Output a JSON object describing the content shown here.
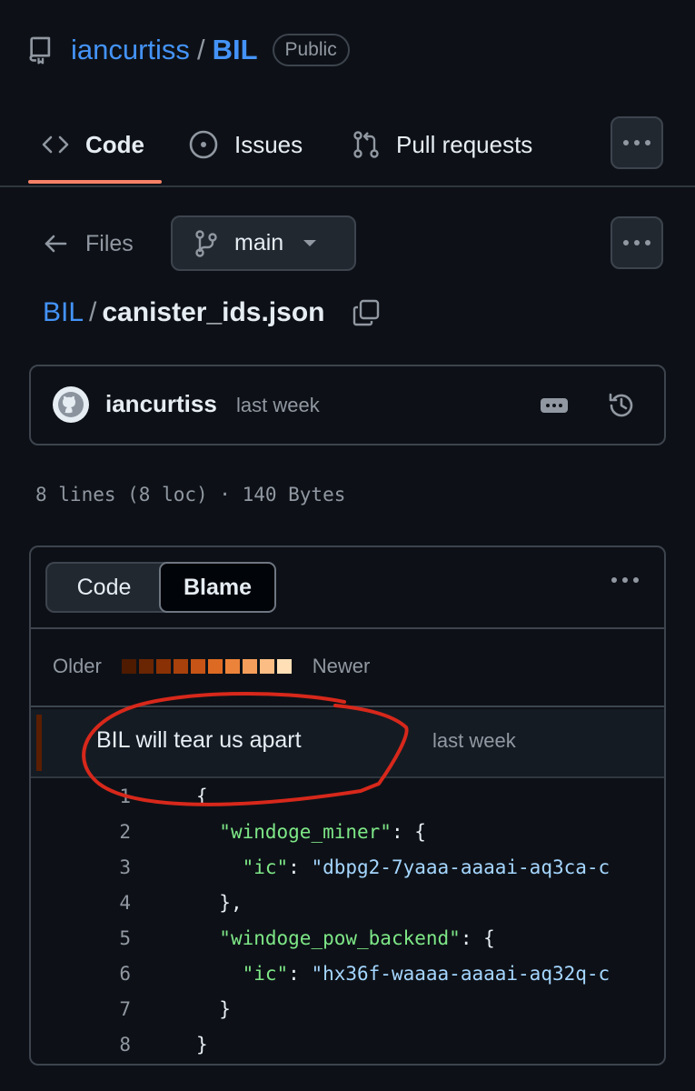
{
  "repo": {
    "owner": "iancurtiss",
    "separator": "/",
    "name": "BIL",
    "visibility": "Public"
  },
  "tabs": [
    {
      "label": "Code",
      "active": true,
      "icon": "code-icon"
    },
    {
      "label": "Issues",
      "active": false,
      "icon": "issue-opened-icon"
    },
    {
      "label": "Pull requests",
      "active": false,
      "icon": "git-pull-request-icon"
    }
  ],
  "files_nav": {
    "back_label": "Files",
    "branch": "main"
  },
  "path": {
    "root": "BIL",
    "separator": "/",
    "file": "canister_ids.json"
  },
  "latest_commit": {
    "author": "iancurtiss",
    "time": "last week"
  },
  "file_meta": "8 lines (8 loc) · 140 Bytes",
  "view_toggle": {
    "code_label": "Code",
    "blame_label": "Blame",
    "active": "Blame"
  },
  "age_legend": {
    "older_label": "Older",
    "newer_label": "Newer",
    "colors": [
      "#4e1a00",
      "#6a2503",
      "#8a3105",
      "#a8410b",
      "#c65416",
      "#dd6a23",
      "#ec833a",
      "#f59e5b",
      "#fbbd83",
      "#ffdfb6"
    ]
  },
  "blame_commit": {
    "message": "BIL will tear us apart",
    "time": "last week",
    "age_color": "#5a1e02"
  },
  "code_lines": [
    {
      "n": "1",
      "indent": "",
      "key": "",
      "sep": "",
      "value": "",
      "tail": "{"
    },
    {
      "n": "2",
      "indent": "  ",
      "key": "\"windoge_miner\"",
      "sep": ": ",
      "value": "",
      "tail": "{"
    },
    {
      "n": "3",
      "indent": "    ",
      "key": "\"ic\"",
      "sep": ": ",
      "value": "\"dbpg2-7yaaa-aaaai-aq3ca-c",
      "tail": ""
    },
    {
      "n": "4",
      "indent": "  ",
      "key": "",
      "sep": "",
      "value": "",
      "tail": "},"
    },
    {
      "n": "5",
      "indent": "  ",
      "key": "\"windoge_pow_backend\"",
      "sep": ": ",
      "value": "",
      "tail": "{"
    },
    {
      "n": "6",
      "indent": "    ",
      "key": "\"ic\"",
      "sep": ": ",
      "value": "\"hx36f-waaaa-aaaai-aq32q-c",
      "tail": ""
    },
    {
      "n": "7",
      "indent": "  ",
      "key": "",
      "sep": "",
      "value": "",
      "tail": "}"
    },
    {
      "n": "8",
      "indent": "",
      "key": "",
      "sep": "",
      "value": "",
      "tail": "}"
    }
  ],
  "annotation": {
    "shape": "red hand-drawn oval",
    "color": "#d7281b"
  }
}
